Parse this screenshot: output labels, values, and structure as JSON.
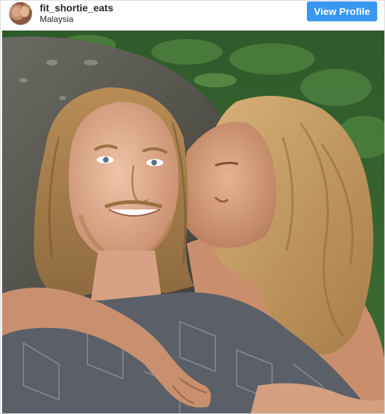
{
  "post": {
    "username": "fit_shortie_eats",
    "location": "Malaysia",
    "view_profile_label": "View Profile",
    "accent_color": "#3897f0"
  },
  "icons": {
    "avatar": "profile-avatar"
  }
}
